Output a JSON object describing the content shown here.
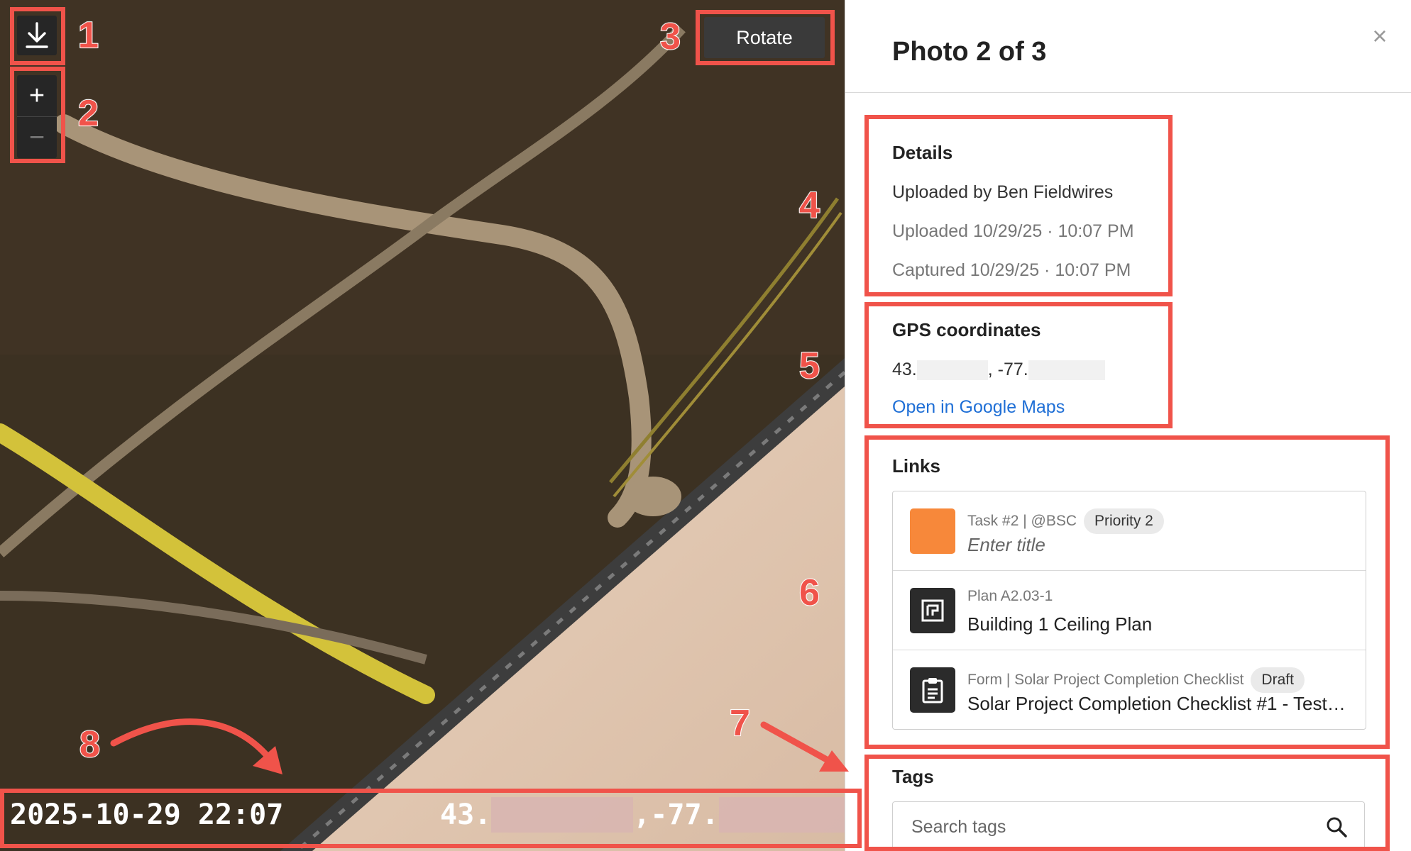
{
  "viewer": {
    "rotate_label": "Rotate",
    "zoom_in_symbol": "+",
    "zoom_out_symbol": "−",
    "stamp": {
      "datetime": "2025-10-29 22:07",
      "lat_prefix": "43.",
      "lon_prefix": ",-77."
    }
  },
  "markers": [
    "1",
    "2",
    "3",
    "4",
    "5",
    "6",
    "7",
    "8"
  ],
  "panel": {
    "title": "Photo 2 of 3",
    "close_symbol": "×",
    "details": {
      "title": "Details",
      "uploaded_by": "Uploaded by Ben Fieldwires",
      "uploaded": "Uploaded 10/29/25 · 10:07 PM",
      "captured": "Captured 10/29/25 · 10:07 PM"
    },
    "gps": {
      "title": "GPS coordinates",
      "lat_prefix": "43.",
      "lon_prefix": ", -77.",
      "map_link": "Open in Google Maps"
    },
    "links": {
      "title": "Links",
      "items": [
        {
          "meta": "Task #2 | @BSC",
          "chip": "Priority 2",
          "main": "Enter title",
          "icon": "task-color-swatch",
          "color": "#f7883a"
        },
        {
          "meta": "Plan A2.03-1",
          "chip": "",
          "main": "Building 1 Ceiling Plan",
          "icon": "plan-icon",
          "color": "#2b2b2b"
        },
        {
          "meta": "Form | Solar Project Completion Checklist",
          "chip": "Draft",
          "main": "Solar Project Completion Checklist #1 - Test…",
          "icon": "clipboard-icon",
          "color": "#2b2b2b"
        }
      ]
    },
    "tags": {
      "title": "Tags",
      "placeholder": "Search tags"
    }
  },
  "colors": {
    "annotation": "#f0534a",
    "link": "#1f6fd6",
    "task_swatch": "#f7883a"
  }
}
